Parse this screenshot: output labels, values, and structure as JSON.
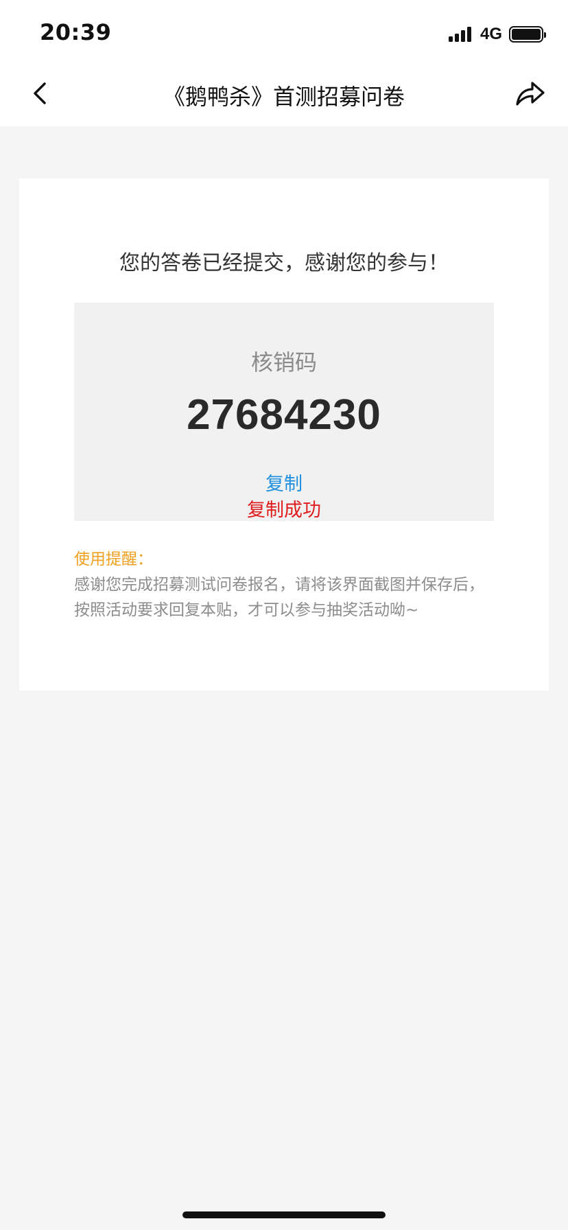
{
  "status_bar": {
    "time": "20:39",
    "network": "4G",
    "icons": [
      "signal-icon",
      "battery-icon"
    ]
  },
  "nav": {
    "title": "《鹅鸭杀》首测招募问卷",
    "icons": [
      "back-arrow-icon",
      "share-icon"
    ]
  },
  "content": {
    "success_message": "您的答卷已经提交，感谢您的参与！",
    "code_label": "核销码",
    "code_value": "27684230",
    "copy_label": "复制",
    "copy_status": "复制成功",
    "reminder_title": "使用提醒：",
    "reminder_text": "感谢您完成招募测试问卷报名，请将该界面截图并保存后，按照活动要求回复本贴，才可以参与抽奖活动呦~"
  },
  "colors": {
    "page_background": "#f5f5f5",
    "code_box_background": "#f1f1f1",
    "copy_link": "#1e90e0",
    "copy_success": "#e01d1d",
    "reminder_title": "#f0a020",
    "reminder_text": "#8c8c8c"
  }
}
